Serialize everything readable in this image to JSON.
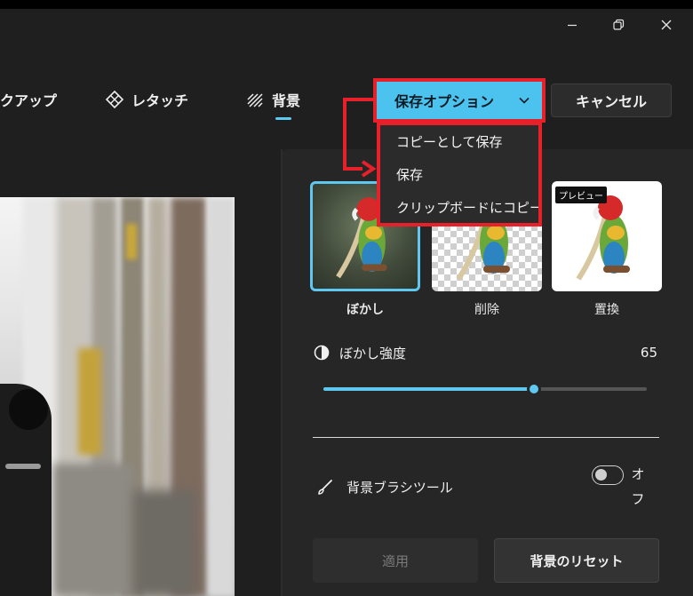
{
  "toolbar": {
    "makeup_label": "クアップ",
    "retouch_label": "レタッチ",
    "background_label": "背景",
    "save_options_label": "保存オプション",
    "cancel_label": "キャンセル"
  },
  "save_menu": {
    "items": [
      "コピーとして保存",
      "保存",
      "クリップボードにコピー"
    ]
  },
  "background_panel": {
    "options": [
      {
        "label": "ぼかし",
        "selected": true
      },
      {
        "label": "削除",
        "selected": false
      },
      {
        "label": "置換",
        "selected": false,
        "badge": "プレビュー"
      }
    ],
    "blur_strength": {
      "label": "ぼかし強度",
      "value": "65",
      "min": 0,
      "max": 100,
      "level": 65
    },
    "brush_tool": {
      "label": "背景ブラシツール",
      "toggle_label": "オフ",
      "enabled": false
    },
    "apply_label": "適用",
    "reset_label": "背景のリセット"
  },
  "colors": {
    "accent": "#5ec8f0",
    "highlight": "#e8202a",
    "panel": "#262626",
    "background": "#1f1f1f"
  },
  "icons": {
    "window": [
      "minimize-icon",
      "restore-icon",
      "close-icon"
    ],
    "retouch": "retouch-icon",
    "background": "background-pattern-icon",
    "dropdown": "chevron-down-icon",
    "blur": "blur-half-circle-icon",
    "brush": "brush-icon"
  }
}
